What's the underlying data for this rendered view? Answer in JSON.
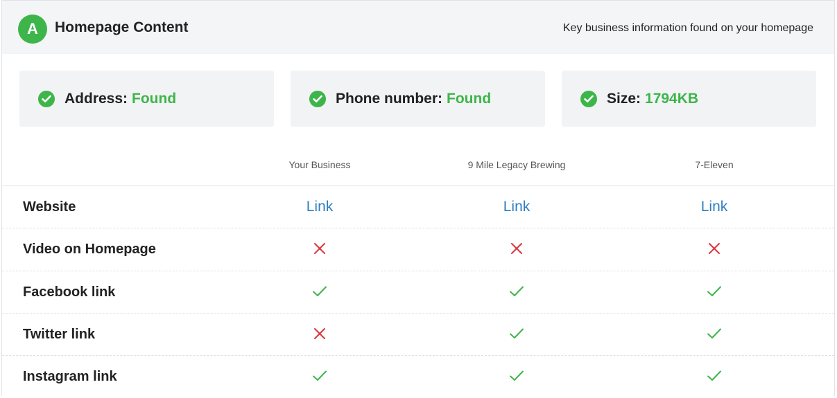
{
  "header": {
    "grade": "A",
    "title": "Homepage Content",
    "subtitle": "Key business information found on your homepage"
  },
  "cards": [
    {
      "label": "Address:",
      "value": "Found",
      "icon": "check-circle-icon"
    },
    {
      "label": "Phone number:",
      "value": "Found",
      "icon": "check-circle-icon"
    },
    {
      "label": "Size:",
      "value": "1794KB",
      "icon": "check-circle-icon"
    }
  ],
  "columns": [
    "Your Business",
    "9 Mile Legacy Brewing",
    "7-Eleven"
  ],
  "rows": [
    {
      "label": "Website",
      "values": [
        "link",
        "link",
        "link"
      ]
    },
    {
      "label": "Video on Homepage",
      "values": [
        "no",
        "no",
        "no"
      ]
    },
    {
      "label": "Facebook link",
      "values": [
        "yes",
        "yes",
        "yes"
      ]
    },
    {
      "label": "Twitter link",
      "values": [
        "no",
        "yes",
        "yes"
      ]
    },
    {
      "label": "Instagram link",
      "values": [
        "yes",
        "yes",
        "yes"
      ]
    }
  ],
  "link_text": "Link",
  "colors": {
    "accent_green": "#3db54a",
    "link_blue": "#2f7fc1",
    "cross_red": "#d9363e"
  }
}
